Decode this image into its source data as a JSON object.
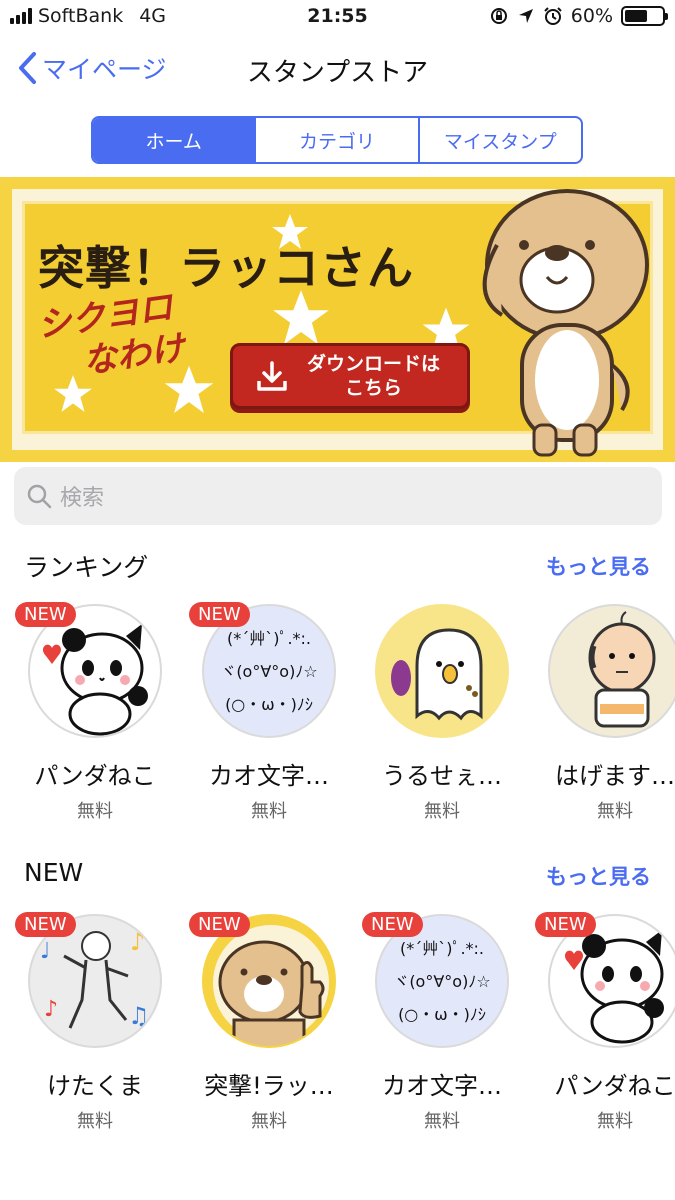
{
  "status": {
    "carrier": "SoftBank",
    "network": "4G",
    "time": "21:55",
    "battery": "60%",
    "battery_level": 0.6
  },
  "nav": {
    "back_label": "マイページ",
    "title": "スタンプストア"
  },
  "segments": [
    {
      "label": "ホーム",
      "active": true
    },
    {
      "label": "カテゴリ",
      "active": false
    },
    {
      "label": "マイスタンプ",
      "active": false
    }
  ],
  "banner": {
    "title": "突撃！ラッコさん",
    "script_line1": "シクヨロ",
    "script_line2": "なわけ",
    "button_line1": "ダウンロードは",
    "button_line2": "こちら"
  },
  "search": {
    "placeholder": "検索"
  },
  "ranking": {
    "title": "ランキング",
    "more": "もっと見る",
    "items": [
      {
        "name": "パンダねこ",
        "price": "無料",
        "badge": "NEW"
      },
      {
        "name": "カオ文字…",
        "price": "無料",
        "badge": "NEW",
        "kaomoji": [
          "(*´艸`)ﾟ.*:.",
          "ヾ(o°∀°o)ﾉ☆",
          "(○・ω・)ﾉｼ"
        ]
      },
      {
        "name": "うるせぇ…",
        "price": "無料"
      },
      {
        "name": "はげます…",
        "price": "無料"
      }
    ]
  },
  "new_section": {
    "title": "NEW",
    "more": "もっと見る",
    "items": [
      {
        "name": "けたくま",
        "price": "無料",
        "badge": "NEW"
      },
      {
        "name": "突撃!ラッ…",
        "price": "無料",
        "badge": "NEW"
      },
      {
        "name": "カオ文字…",
        "price": "無料",
        "badge": "NEW",
        "kaomoji": [
          "(*´艸`)ﾟ.*:.",
          "ヾ(o°∀°o)ﾉ☆",
          "(○・ω・)ﾉｼ"
        ]
      },
      {
        "name": "パンダねこ",
        "price": "無料",
        "badge": "NEW"
      }
    ]
  },
  "colors": {
    "accent": "#4a6cf0",
    "badge": "#e8403a",
    "banner_yellow": "#f5d342"
  }
}
